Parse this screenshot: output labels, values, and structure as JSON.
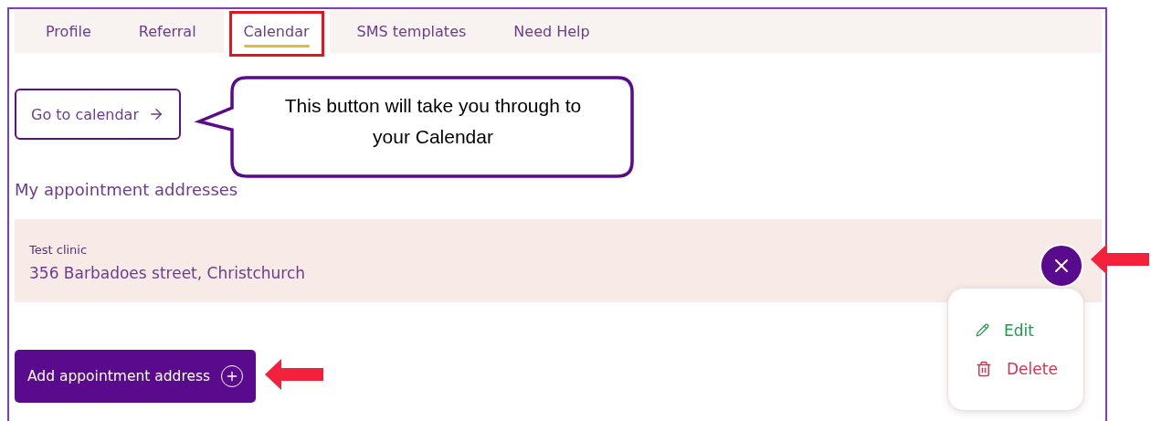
{
  "tabs": [
    {
      "label": "Profile",
      "selected": false
    },
    {
      "label": "Referral",
      "selected": false
    },
    {
      "label": "Calendar",
      "selected": true
    },
    {
      "label": "SMS templates",
      "selected": false
    },
    {
      "label": "Need Help",
      "selected": false
    }
  ],
  "go_to_calendar_button": {
    "label": "Go to calendar"
  },
  "callout": {
    "text": "This button will take you through to your Calendar"
  },
  "section_title": "My appointment addresses",
  "addresses": [
    {
      "name": "Test clinic",
      "address": "356 Barbadoes street, Christchurch",
      "menu_open": true
    }
  ],
  "action_menu": {
    "items": [
      {
        "kind": "edit",
        "label": "Edit"
      },
      {
        "kind": "delete",
        "label": "Delete"
      }
    ]
  },
  "add_button": {
    "label": "Add appointment address"
  }
}
